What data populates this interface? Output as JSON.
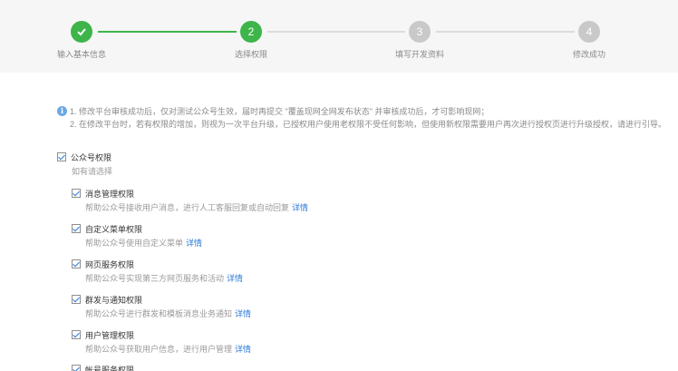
{
  "steps": [
    {
      "number": "",
      "label": "输入基本信息",
      "state": "done"
    },
    {
      "number": "2",
      "label": "选择权限",
      "state": "active"
    },
    {
      "number": "3",
      "label": "填写开发资料",
      "state": "todo"
    },
    {
      "number": "4",
      "label": "修改成功",
      "state": "todo"
    }
  ],
  "notice": {
    "line1": "1. 修改平台审核成功后，仅对测试公众号生效，届时再提交 \"覆盖现网全网发布状态\" 并审核成功后，才可影响现网；",
    "line2": "2. 在修改平台时，若有权限的增加，则视为一次平台升级，已授权用户使用老权限不受任何影响，但使用新权限需要用户再次进行授权页进行升级授权，请进行引导。"
  },
  "group": {
    "title": "公众号权限",
    "subtitle": "如有请选择"
  },
  "permissions": [
    {
      "title": "消息管理权限",
      "desc": "帮助公众号接收用户消息，进行人工客服回复或自动回复",
      "link": "详情"
    },
    {
      "title": "自定义菜单权限",
      "desc": "帮助公众号使用自定义菜单",
      "link": "详情"
    },
    {
      "title": "网页服务权限",
      "desc": "帮助公众号实现第三方网页服务和活动",
      "link": "详情"
    },
    {
      "title": "群发与通知权限",
      "desc": "帮助公众号进行群发和模板消息业务通知",
      "link": "详情"
    },
    {
      "title": "用户管理权限",
      "desc": "帮助公众号获取用户信息，进行用户管理",
      "link": "详情"
    },
    {
      "title": "帐号服务权限",
      "desc": "",
      "link": ""
    }
  ],
  "colors": {
    "accent_green": "#3db54a",
    "link_blue": "#2b7ad8",
    "step_todo": "#c9c9c9"
  }
}
